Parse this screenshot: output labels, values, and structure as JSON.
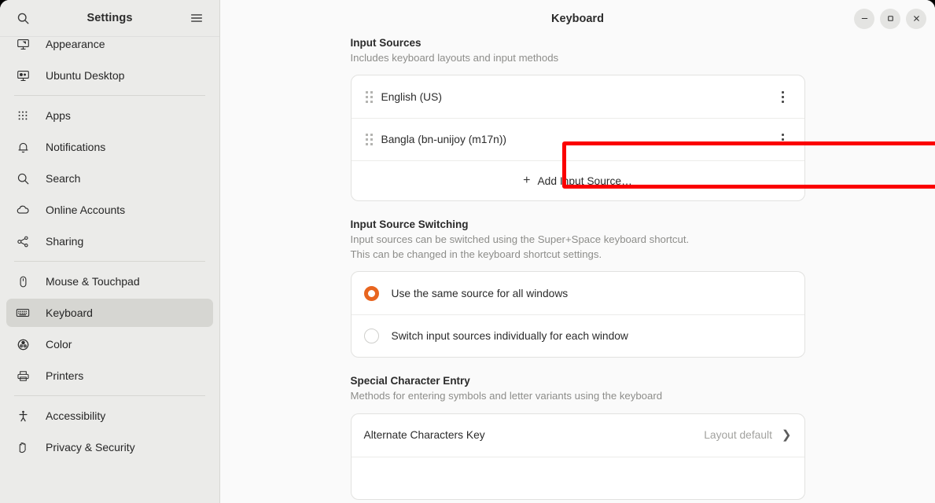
{
  "sidebar": {
    "title": "Settings",
    "search_icon": "search-icon",
    "menu_icon": "hamburger-menu-icon",
    "groups": [
      {
        "items": [
          {
            "label": "Appearance",
            "icon": "appearance-icon",
            "selected": false
          },
          {
            "label": "Ubuntu Desktop",
            "icon": "ubuntu-desktop-icon",
            "selected": false
          }
        ]
      },
      {
        "items": [
          {
            "label": "Apps",
            "icon": "apps-grid-icon",
            "selected": false
          },
          {
            "label": "Notifications",
            "icon": "bell-icon",
            "selected": false
          },
          {
            "label": "Search",
            "icon": "search-icon",
            "selected": false
          },
          {
            "label": "Online Accounts",
            "icon": "cloud-icon",
            "selected": false
          },
          {
            "label": "Sharing",
            "icon": "share-nodes-icon",
            "selected": false
          }
        ]
      },
      {
        "items": [
          {
            "label": "Mouse & Touchpad",
            "icon": "mouse-icon",
            "selected": false
          },
          {
            "label": "Keyboard",
            "icon": "keyboard-icon",
            "selected": true
          },
          {
            "label": "Color",
            "icon": "color-wheel-icon",
            "selected": false
          },
          {
            "label": "Printers",
            "icon": "printer-icon",
            "selected": false
          }
        ]
      },
      {
        "items": [
          {
            "label": "Accessibility",
            "icon": "accessibility-person-icon",
            "selected": false
          },
          {
            "label": "Privacy & Security",
            "icon": "hand-shield-icon",
            "selected": false
          }
        ]
      }
    ]
  },
  "titlebar": {
    "title": "Keyboard",
    "minimize_label": "–",
    "maximize_label": "□",
    "close_label": "✕"
  },
  "input_sources": {
    "heading": "Input Sources",
    "description": "Includes keyboard layouts and input methods",
    "sources": [
      {
        "label": "English (US)",
        "highlighted": false
      },
      {
        "label": "Bangla (bn-unijoy (m17n))",
        "highlighted": true
      }
    ],
    "add_label": "Add Input Source…",
    "add_icon": "plus-icon"
  },
  "input_source_switching": {
    "heading": "Input Source Switching",
    "description_line1": "Input sources can be switched using the Super+Space keyboard shortcut.",
    "description_line2": "This can be changed in the keyboard shortcut settings.",
    "options": [
      {
        "label": "Use the same source for all windows",
        "selected": true
      },
      {
        "label": "Switch input sources individually for each window",
        "selected": false
      }
    ]
  },
  "special_character_entry": {
    "heading": "Special Character Entry",
    "description": "Methods for entering symbols and letter variants using the keyboard",
    "rows": [
      {
        "label": "Alternate Characters Key",
        "value": "Layout default",
        "chevron": "❯"
      }
    ]
  },
  "colors": {
    "accent": "#e8651f",
    "highlight_box": "#fb0000",
    "sidebar_bg": "#ebebe9",
    "main_bg": "#fafafa",
    "card_bg": "#ffffff"
  }
}
